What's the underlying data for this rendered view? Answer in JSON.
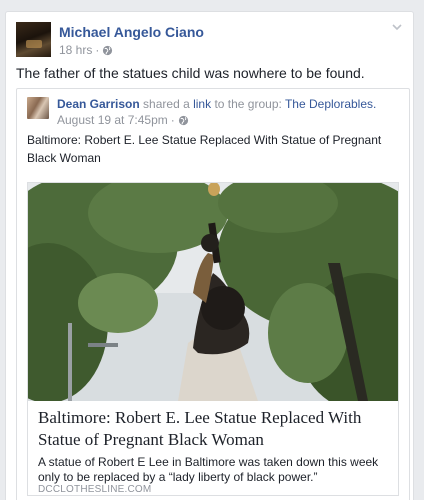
{
  "post": {
    "author": "Michael Angelo Ciano",
    "time": "18 hrs",
    "separator": "·",
    "text": "The father of the statues child was nowhere to be found."
  },
  "shared": {
    "author": "Dean Garrison",
    "verb1": "shared a",
    "link_word": "link",
    "verb2": "to the group:",
    "group": "The Deplorables.",
    "time": "August 19 at 7:45pm",
    "separator": "·",
    "text": "Baltimore: Robert E. Lee Statue Replaced With Statue of Pregnant Black Woman"
  },
  "link": {
    "title": "Baltimore: Robert E. Lee Statue Replaced With Statue of Pregnant Black Woman",
    "description": "A statue of Robert E Lee in Baltimore was taken down this week only to be replaced by a “lady liberty of black power.”",
    "domain": "DCCLOTHESLINE.COM"
  },
  "icons": {
    "globe": "globe-icon",
    "chevron": "chevron-down-icon"
  }
}
